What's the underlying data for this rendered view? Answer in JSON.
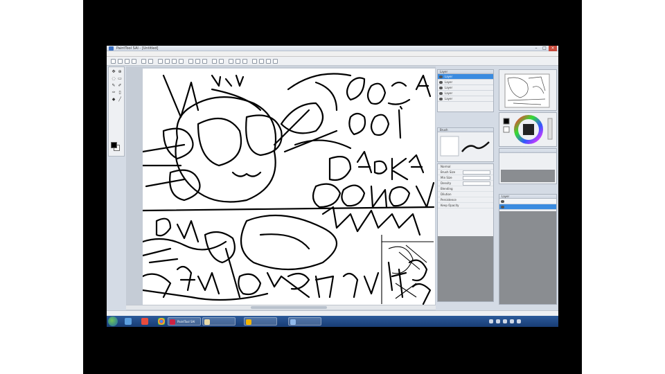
{
  "window": {
    "title": "PaintTool SAI - [Untitled]"
  },
  "menu": [
    "File",
    "Edit",
    "Image",
    "Layer",
    "Selection",
    "Filter",
    "View",
    "Window",
    "Others",
    "Help"
  ],
  "layers_panel": {
    "title": "Layer",
    "items": [
      "Layer",
      "Layer",
      "Layer",
      "Layer",
      "Layer"
    ]
  },
  "brush_panel": {
    "title": "Brush"
  },
  "tool_options": {
    "rows": [
      "Normal",
      "Brush Size",
      "Min Size",
      "Density",
      "Blending",
      "Dilution",
      "Persistence",
      "Keep Opacity"
    ]
  },
  "right_layers": {
    "title": "Layer"
  },
  "statusbar": {
    "text": "Memory load"
  },
  "taskbar": {
    "items": [
      "PaintTool SAI",
      "",
      "",
      ""
    ],
    "clock": [
      "",
      ""
    ]
  },
  "colors": {
    "screen_bg": "#d4dbe5",
    "selection": "#3a8be0",
    "taskbar": "#1f4a86"
  },
  "icons": [
    "start-orb-icon",
    "chrome-icon",
    "explorer-icon",
    "media-player-icon",
    "color-wheel-icon",
    "eye-icon"
  ]
}
